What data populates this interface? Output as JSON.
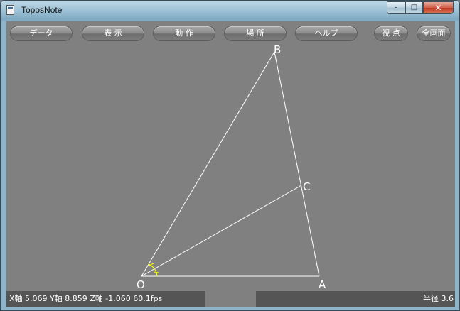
{
  "window": {
    "title": "ToposNote"
  },
  "toolbar": {
    "data": "データ",
    "display": "表 示",
    "action": "動 作",
    "place": "場 所",
    "help": "ヘルプ",
    "view": "視 点",
    "fullscreen": "全画面"
  },
  "figure": {
    "labels": {
      "O": "O",
      "A": "A",
      "B": "B",
      "C": "C"
    }
  },
  "status": {
    "coords": "X軸  5.069 Y軸  8.859 Z軸 -1.060  60.1fps",
    "radius": "半径  3.6"
  },
  "colors": {
    "line": "#ffffff",
    "angle_mark": "#ffff00",
    "background": "#808080"
  }
}
